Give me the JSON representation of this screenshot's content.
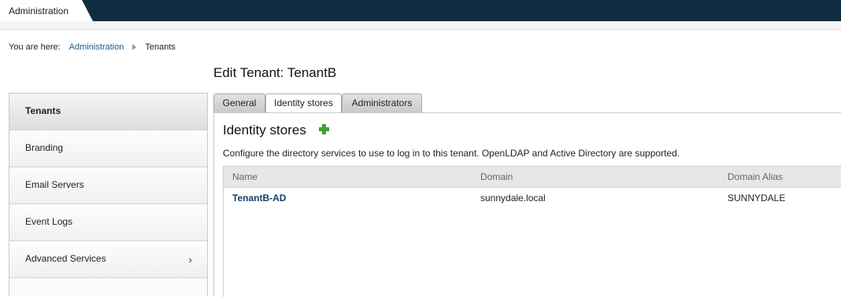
{
  "header": {
    "tab_label": "Administration"
  },
  "breadcrumb": {
    "prefix": "You are here:",
    "items": [
      "Administration",
      "Tenants"
    ]
  },
  "page_title": "Edit Tenant: TenantB",
  "sidebar": {
    "items": [
      {
        "label": "Tenants",
        "active": true
      },
      {
        "label": "Branding"
      },
      {
        "label": "Email Servers"
      },
      {
        "label": "Event Logs"
      },
      {
        "label": "Advanced Services",
        "has_chevron": true
      }
    ],
    "chevron": "›"
  },
  "tabs": [
    {
      "label": "General"
    },
    {
      "label": "Identity stores",
      "active": true
    },
    {
      "label": "Administrators"
    }
  ],
  "identity_stores": {
    "title": "Identity stores",
    "add_icon": "plus-icon",
    "description": "Configure the directory services to use to log in to this tenant. OpenLDAP and Active Directory are supported.",
    "columns": [
      "Name",
      "Domain",
      "Domain Alias"
    ],
    "rows": [
      {
        "name": "TenantB-AD",
        "domain": "sunnydale.local",
        "alias": "SUNNYDALE"
      }
    ]
  },
  "colors": {
    "topbar": "#0e2d41",
    "link": "#1a5a8a",
    "add_icon": "#3aa83a"
  }
}
